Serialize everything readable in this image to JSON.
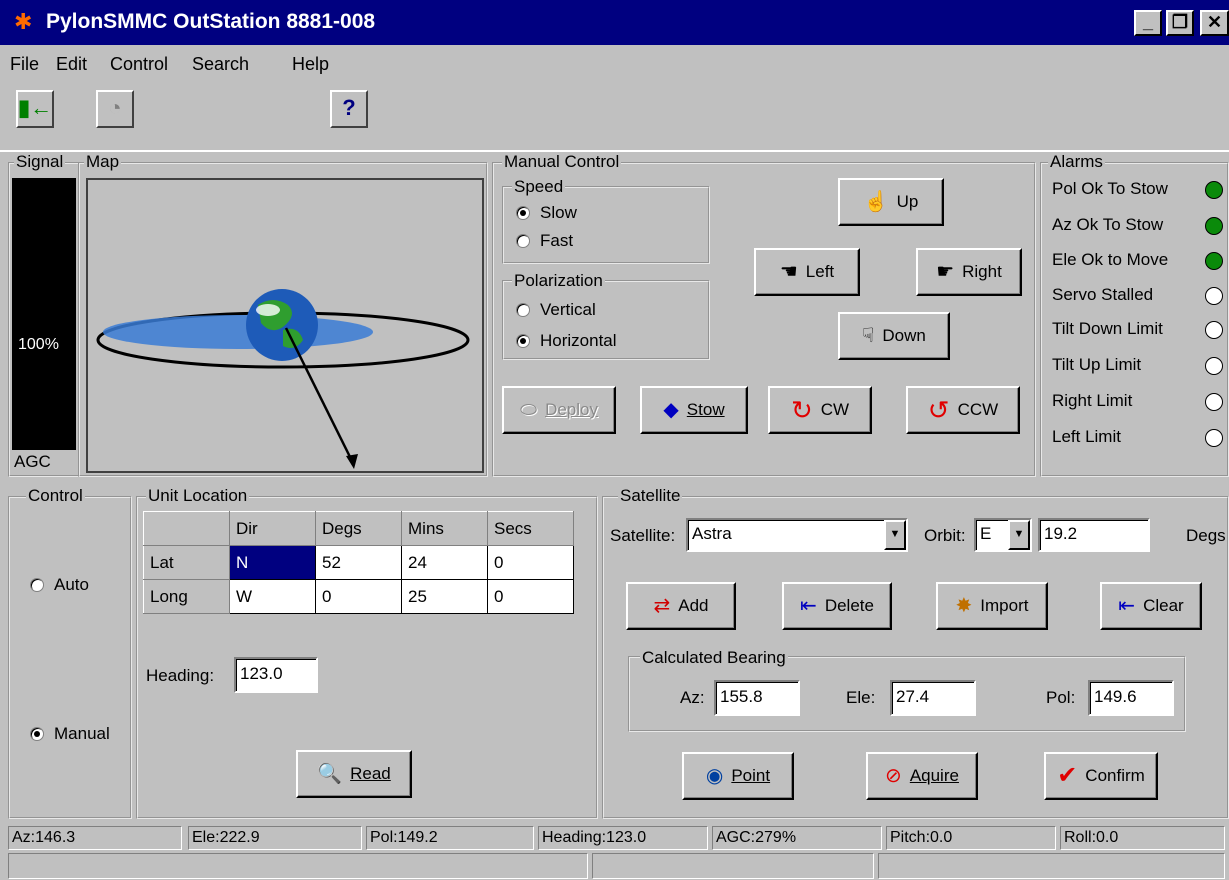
{
  "window": {
    "title": "PylonSMMC OutStation 8881-008",
    "buttons": [
      "minimize",
      "maximize",
      "close"
    ]
  },
  "menu": [
    {
      "label": "File"
    },
    {
      "label": "Edit"
    },
    {
      "label": "Control"
    },
    {
      "label": "Search"
    },
    {
      "label": "Help"
    }
  ],
  "toolbar": {
    "icons": [
      "exit-door-icon",
      "dial-icon",
      "help-question-icon"
    ]
  },
  "signal": {
    "legend": "Signal",
    "level_percent": "100%",
    "footer": "AGC"
  },
  "map": {
    "legend": "Map"
  },
  "manual_control": {
    "legend": "Manual Control",
    "speed": {
      "legend": "Speed",
      "options": [
        "Slow",
        "Fast"
      ],
      "selected": "Slow"
    },
    "polarization": {
      "legend": "Polarization",
      "options": [
        "Vertical",
        "Horizontal"
      ],
      "selected": "Horizontal"
    },
    "buttons": {
      "up": "Up",
      "left": "Left",
      "right": "Right",
      "down": "Down",
      "deploy": "Deploy",
      "stow": "Stow",
      "cw": "CW",
      "ccw": "CCW"
    }
  },
  "alarms": {
    "legend": "Alarms",
    "items": [
      {
        "label": "Pol Ok To Stow",
        "active": true
      },
      {
        "label": "Az Ok To Stow",
        "active": true
      },
      {
        "label": "Ele Ok to Move",
        "active": true
      },
      {
        "label": "Servo Stalled",
        "active": false
      },
      {
        "label": "Tilt Down Limit",
        "active": false
      },
      {
        "label": "Tilt Up Limit",
        "active": false
      },
      {
        "label": "Right Limit",
        "active": false
      },
      {
        "label": "Left Limit",
        "active": false
      }
    ],
    "active_color": "#0a8a0a"
  },
  "control": {
    "legend": "Control",
    "options": [
      "Auto",
      "Manual"
    ],
    "selected": "Manual"
  },
  "unit_location": {
    "legend": "Unit Location",
    "columns": [
      "",
      "Dir",
      "Degs",
      "Mins",
      "Secs"
    ],
    "rows": [
      {
        "label": "Lat",
        "dir": "N",
        "degs": "52",
        "mins": "24",
        "secs": "0"
      },
      {
        "label": "Long",
        "dir": "W",
        "degs": "0",
        "mins": "25",
        "secs": "0"
      }
    ],
    "heading_label": "Heading:",
    "heading_value": "123.0",
    "read_button": "Read"
  },
  "satellite": {
    "legend": "Satellite",
    "satellite_label": "Satellite:",
    "satellite_value": "Astra",
    "orbit_label": "Orbit:",
    "orbit_value": "E",
    "orbit_degs": "19.2",
    "degs_label": "Degs",
    "buttons": {
      "add": "Add",
      "delete": "Delete",
      "import": "Import",
      "clear": "Clear",
      "point": "Point",
      "aquire": "Aquire",
      "confirm": "Confirm"
    },
    "bearing": {
      "legend": "Calculated Bearing",
      "az_label": "Az:",
      "az_value": "155.8",
      "ele_label": "Ele:",
      "ele_value": "27.4",
      "pol_label": "Pol:",
      "pol_value": "149.6"
    }
  },
  "status_bar": [
    "Az:146.3",
    "Ele:222.9",
    "Pol:149.2",
    "Heading:123.0",
    "AGC:279%",
    "Pitch:0.0",
    "Roll:0.0"
  ],
  "colors": {
    "title_bar": "#000080",
    "face": "#c0c0c0",
    "selection": "#000080"
  }
}
